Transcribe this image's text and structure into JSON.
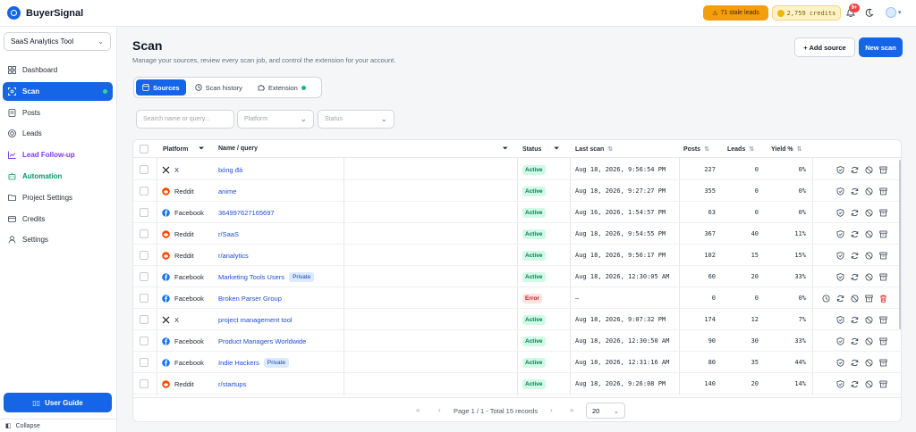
{
  "app": {
    "name": "BuyerSignal"
  },
  "topbar": {
    "stale_leads": "71 stale leads",
    "credits": "2,759 credits",
    "notifications": "9+"
  },
  "sidebar": {
    "project": "SaaS Analytics Tool",
    "items": [
      {
        "label": "Dashboard",
        "icon": "dashboard-icon"
      },
      {
        "label": "Scan",
        "icon": "scan-icon",
        "active": true
      },
      {
        "label": "Posts",
        "icon": "posts-icon"
      },
      {
        "label": "Leads",
        "icon": "leads-icon"
      },
      {
        "label": "Lead Follow-up",
        "icon": "chart-icon"
      },
      {
        "label": "Automation",
        "icon": "automation-icon"
      },
      {
        "label": "Project Settings",
        "icon": "folder-icon"
      },
      {
        "label": "Credits",
        "icon": "card-icon"
      },
      {
        "label": "Settings",
        "icon": "user-icon"
      }
    ],
    "guide": "User Guide",
    "collapse": "Collapse"
  },
  "header": {
    "title": "Scan",
    "subtitle": "Manage your sources, review every scan job, and control the extension for your account.",
    "add_source": "+ Add source",
    "new_scan": "New scan"
  },
  "tabs": [
    {
      "label": "Sources",
      "active": true
    },
    {
      "label": "Scan history"
    },
    {
      "label": "Extension"
    }
  ],
  "filters": {
    "search_placeholder": "Search name or query...",
    "platform_placeholder": "Platform",
    "status_placeholder": "Status"
  },
  "table": {
    "headers": {
      "platform": "Platform",
      "name": "Name / query",
      "status": "Status",
      "last_scan": "Last scan",
      "posts": "Posts",
      "leads": "Leads",
      "yield": "Yield %"
    },
    "rows": [
      {
        "platform": "X",
        "name": "bóng đá",
        "status": "Active",
        "last_scan": "Aug 18, 2026, 9:56:54 PM",
        "posts": "227",
        "leads": "0",
        "yield": "0%"
      },
      {
        "platform": "Reddit",
        "name": "anime",
        "status": "Active",
        "last_scan": "Aug 18, 2026, 9:27:27 PM",
        "posts": "355",
        "leads": "0",
        "yield": "0%"
      },
      {
        "platform": "Facebook",
        "name": "364997627165697",
        "status": "Active",
        "last_scan": "Aug 16, 2026, 1:54:57 PM",
        "posts": "63",
        "leads": "0",
        "yield": "0%"
      },
      {
        "platform": "Reddit",
        "name": "r/SaaS",
        "status": "Active",
        "last_scan": "Aug 18, 2026, 9:54:55 PM",
        "posts": "367",
        "leads": "40",
        "yield": "11%"
      },
      {
        "platform": "Reddit",
        "name": "r/analytics",
        "status": "Active",
        "last_scan": "Aug 18, 2026, 9:56:17 PM",
        "posts": "102",
        "leads": "15",
        "yield": "15%"
      },
      {
        "platform": "Facebook",
        "name": "Marketing Tools Users",
        "private": "Private",
        "status": "Active",
        "last_scan": "Aug 18, 2026, 12:30:05 AM",
        "posts": "60",
        "leads": "20",
        "yield": "33%"
      },
      {
        "platform": "Facebook",
        "name": "Broken Parser Group",
        "status": "Error",
        "last_scan": "—",
        "posts": "0",
        "leads": "0",
        "yield": "0%",
        "extra_actions": true
      },
      {
        "platform": "X",
        "name": "project management tool",
        "status": "Active",
        "last_scan": "Aug 18, 2026, 9:07:32 PM",
        "posts": "174",
        "leads": "12",
        "yield": "7%"
      },
      {
        "platform": "Facebook",
        "name": "Product Managers Worldwide",
        "status": "Active",
        "last_scan": "Aug 18, 2026, 12:30:50 AM",
        "posts": "90",
        "leads": "30",
        "yield": "33%"
      },
      {
        "platform": "Facebook",
        "name": "Indie Hackers",
        "private": "Private",
        "status": "Active",
        "last_scan": "Aug 18, 2026, 12:31:16 AM",
        "posts": "80",
        "leads": "35",
        "yield": "44%"
      },
      {
        "platform": "Reddit",
        "name": "r/startups",
        "status": "Active",
        "last_scan": "Aug 18, 2026, 9:26:08 PM",
        "posts": "140",
        "leads": "20",
        "yield": "14%"
      }
    ]
  },
  "pagination": {
    "text": "Page 1 / 1 - Total 15 records",
    "page_size": "20"
  },
  "colors": {
    "primary": "#1565e6",
    "active_bg": "#d1fae5",
    "error_bg": "#fee2e2",
    "stale": "#f59e0b"
  }
}
